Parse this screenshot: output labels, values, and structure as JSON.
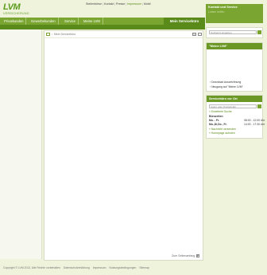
{
  "brand": {
    "logo_text": "LVM",
    "logo_sub": "VERSICHERUNG"
  },
  "topnav": {
    "items": [
      "Stellenbörse",
      "Kontakt",
      "Presse",
      "Impressum",
      "Mobil"
    ]
  },
  "mainnav": {
    "items": [
      "Privatkunden",
      "Gewerbekunden",
      "Service",
      "Meine LVM"
    ],
    "active": "Mein Servicebüro"
  },
  "breadcrumb": {
    "current": "Mein Servicebüro"
  },
  "content": {
    "to_top": "Zum Seitenanfang"
  },
  "sidebar": {
    "contact": {
      "title": "Kontakt und Service",
      "sub": "Lotsen helfen"
    },
    "search": {
      "placeholder": "Suchwort eingeben"
    },
    "mylvm": {
      "title": "\"Meine LVM\"",
      "links": [
        "Download Auszeichnung",
        "Neugang auf \"Meine LVM\""
      ]
    },
    "office": {
      "title": "Servicebüro vor Ort",
      "input": "Agent oder Postleitzahl",
      "extended": "Erweiterte Suche",
      "hours_title": "Bürozeiten",
      "hours": [
        {
          "days": "Mo. - Fr.",
          "time": "08:00 - 12:00 Uhr"
        },
        {
          "days": "Mo.,Di,Do., Fr.",
          "time": "14:00 - 17:30 Uhr"
        }
      ],
      "links": [
        "Nachricht versenden",
        "Homepage aufrufen"
      ]
    }
  },
  "footer": {
    "items": [
      "Copyright © LVM 2012, Alle Rechte vorbehalten",
      "Datenschutzerklärung",
      "Impressum",
      "Nutzungsbedingungen",
      "Sitemap"
    ]
  },
  "colors": {
    "green": "#7aa531",
    "dark_green": "#5a8a1a",
    "bg": "#eff3dc"
  }
}
